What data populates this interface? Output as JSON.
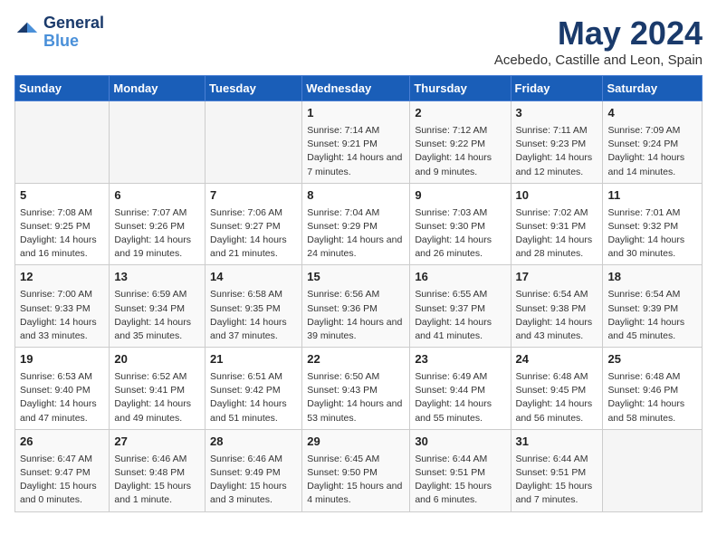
{
  "header": {
    "logo_line1": "General",
    "logo_line2": "Blue",
    "month": "May 2024",
    "location": "Acebedo, Castille and Leon, Spain"
  },
  "weekdays": [
    "Sunday",
    "Monday",
    "Tuesday",
    "Wednesday",
    "Thursday",
    "Friday",
    "Saturday"
  ],
  "weeks": [
    [
      {
        "day": "",
        "empty": true
      },
      {
        "day": "",
        "empty": true
      },
      {
        "day": "",
        "empty": true
      },
      {
        "day": "1",
        "sunrise": "7:14 AM",
        "sunset": "9:21 PM",
        "daylight": "14 hours and 7 minutes."
      },
      {
        "day": "2",
        "sunrise": "7:12 AM",
        "sunset": "9:22 PM",
        "daylight": "14 hours and 9 minutes."
      },
      {
        "day": "3",
        "sunrise": "7:11 AM",
        "sunset": "9:23 PM",
        "daylight": "14 hours and 12 minutes."
      },
      {
        "day": "4",
        "sunrise": "7:09 AM",
        "sunset": "9:24 PM",
        "daylight": "14 hours and 14 minutes."
      }
    ],
    [
      {
        "day": "5",
        "sunrise": "7:08 AM",
        "sunset": "9:25 PM",
        "daylight": "14 hours and 16 minutes."
      },
      {
        "day": "6",
        "sunrise": "7:07 AM",
        "sunset": "9:26 PM",
        "daylight": "14 hours and 19 minutes."
      },
      {
        "day": "7",
        "sunrise": "7:06 AM",
        "sunset": "9:27 PM",
        "daylight": "14 hours and 21 minutes."
      },
      {
        "day": "8",
        "sunrise": "7:04 AM",
        "sunset": "9:29 PM",
        "daylight": "14 hours and 24 minutes."
      },
      {
        "day": "9",
        "sunrise": "7:03 AM",
        "sunset": "9:30 PM",
        "daylight": "14 hours and 26 minutes."
      },
      {
        "day": "10",
        "sunrise": "7:02 AM",
        "sunset": "9:31 PM",
        "daylight": "14 hours and 28 minutes."
      },
      {
        "day": "11",
        "sunrise": "7:01 AM",
        "sunset": "9:32 PM",
        "daylight": "14 hours and 30 minutes."
      }
    ],
    [
      {
        "day": "12",
        "sunrise": "7:00 AM",
        "sunset": "9:33 PM",
        "daylight": "14 hours and 33 minutes."
      },
      {
        "day": "13",
        "sunrise": "6:59 AM",
        "sunset": "9:34 PM",
        "daylight": "14 hours and 35 minutes."
      },
      {
        "day": "14",
        "sunrise": "6:58 AM",
        "sunset": "9:35 PM",
        "daylight": "14 hours and 37 minutes."
      },
      {
        "day": "15",
        "sunrise": "6:56 AM",
        "sunset": "9:36 PM",
        "daylight": "14 hours and 39 minutes."
      },
      {
        "day": "16",
        "sunrise": "6:55 AM",
        "sunset": "9:37 PM",
        "daylight": "14 hours and 41 minutes."
      },
      {
        "day": "17",
        "sunrise": "6:54 AM",
        "sunset": "9:38 PM",
        "daylight": "14 hours and 43 minutes."
      },
      {
        "day": "18",
        "sunrise": "6:54 AM",
        "sunset": "9:39 PM",
        "daylight": "14 hours and 45 minutes."
      }
    ],
    [
      {
        "day": "19",
        "sunrise": "6:53 AM",
        "sunset": "9:40 PM",
        "daylight": "14 hours and 47 minutes."
      },
      {
        "day": "20",
        "sunrise": "6:52 AM",
        "sunset": "9:41 PM",
        "daylight": "14 hours and 49 minutes."
      },
      {
        "day": "21",
        "sunrise": "6:51 AM",
        "sunset": "9:42 PM",
        "daylight": "14 hours and 51 minutes."
      },
      {
        "day": "22",
        "sunrise": "6:50 AM",
        "sunset": "9:43 PM",
        "daylight": "14 hours and 53 minutes."
      },
      {
        "day": "23",
        "sunrise": "6:49 AM",
        "sunset": "9:44 PM",
        "daylight": "14 hours and 55 minutes."
      },
      {
        "day": "24",
        "sunrise": "6:48 AM",
        "sunset": "9:45 PM",
        "daylight": "14 hours and 56 minutes."
      },
      {
        "day": "25",
        "sunrise": "6:48 AM",
        "sunset": "9:46 PM",
        "daylight": "14 hours and 58 minutes."
      }
    ],
    [
      {
        "day": "26",
        "sunrise": "6:47 AM",
        "sunset": "9:47 PM",
        "daylight": "15 hours and 0 minutes."
      },
      {
        "day": "27",
        "sunrise": "6:46 AM",
        "sunset": "9:48 PM",
        "daylight": "15 hours and 1 minute."
      },
      {
        "day": "28",
        "sunrise": "6:46 AM",
        "sunset": "9:49 PM",
        "daylight": "15 hours and 3 minutes."
      },
      {
        "day": "29",
        "sunrise": "6:45 AM",
        "sunset": "9:50 PM",
        "daylight": "15 hours and 4 minutes."
      },
      {
        "day": "30",
        "sunrise": "6:44 AM",
        "sunset": "9:51 PM",
        "daylight": "15 hours and 6 minutes."
      },
      {
        "day": "31",
        "sunrise": "6:44 AM",
        "sunset": "9:51 PM",
        "daylight": "15 hours and 7 minutes."
      },
      {
        "day": "",
        "empty": true
      }
    ]
  ]
}
